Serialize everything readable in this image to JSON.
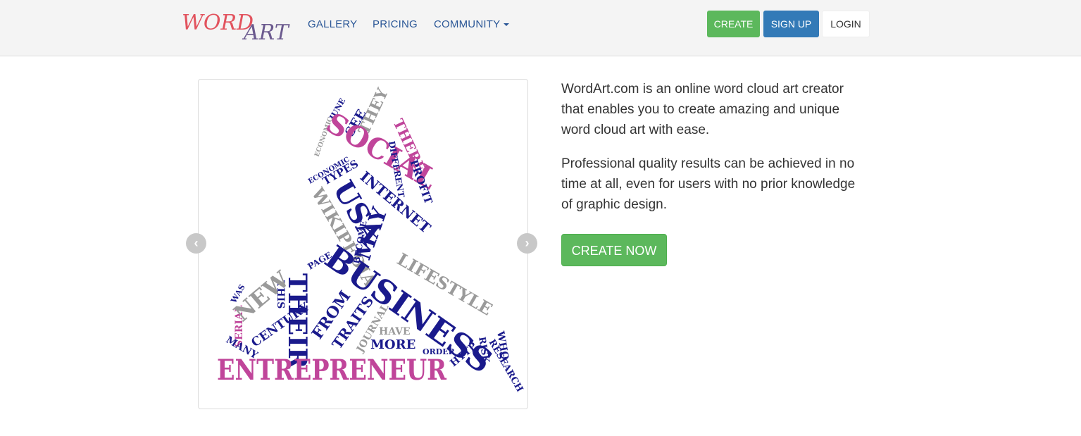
{
  "navbar": {
    "logo_word": "WORD",
    "logo_art": "ART",
    "links": {
      "gallery": "GALLERY",
      "pricing": "PRICING",
      "community": "COMMUNITY"
    },
    "buttons": {
      "create": "CREATE",
      "signup": "SIGN UP",
      "login": "LOGIN"
    }
  },
  "carousel": {
    "prev_icon": "chevron-left-icon",
    "next_icon": "chevron-right-icon",
    "prev_glyph": "‹",
    "next_glyph": "›",
    "words": {
      "entrepreneur": "ENTREPRENEUR",
      "business": "BUSINESS",
      "social": "SOCIAL",
      "usa": "USA",
      "internet": "INTERNET",
      "their": "THEIR",
      "lifestyle": "LIFESTYLE",
      "may": "MAY",
      "new": "NEW",
      "from": "FROM",
      "traits": "TRAITS",
      "more": "MORE",
      "wikipedia": "WIKIPEDIA",
      "types": "TYPES",
      "profit": "PROFIT",
      "there": "THERE",
      "they": "THEY",
      "see": "SEE",
      "century": "CENTURY",
      "research": "RESEARCH",
      "http": "HTTP",
      "serial": "SERIAL",
      "many": "MANY",
      "different": "DIFFERENT",
      "have": "HAVE",
      "become": "BECOME",
      "page": "PAGE",
      "who": "WHO",
      "risk": "RISK",
      "june": "JUNE",
      "order": "ORDER",
      "economic": "ECONOMIC",
      "this": "THIS",
      "was": "WAS",
      "journal": "JOURNAL"
    },
    "colors": {
      "navy": "#1a1a8c",
      "magenta": "#c0459a",
      "gray": "#9a9a9a"
    }
  },
  "description": {
    "paragraph_1": "WordArt.com is an online word cloud art creator that enables you to create amazing and unique word cloud art with ease.",
    "paragraph_2": "Professional quality results can be achieved in no time at all, even for users with no prior knowledge of graphic design.",
    "cta": "CREATE NOW"
  },
  "colors": {
    "green": "#5cb85c",
    "blue": "#337ab7",
    "nav_link": "#2b5797",
    "logo_red": "#e2535e",
    "logo_purple": "#6b5a8e"
  }
}
